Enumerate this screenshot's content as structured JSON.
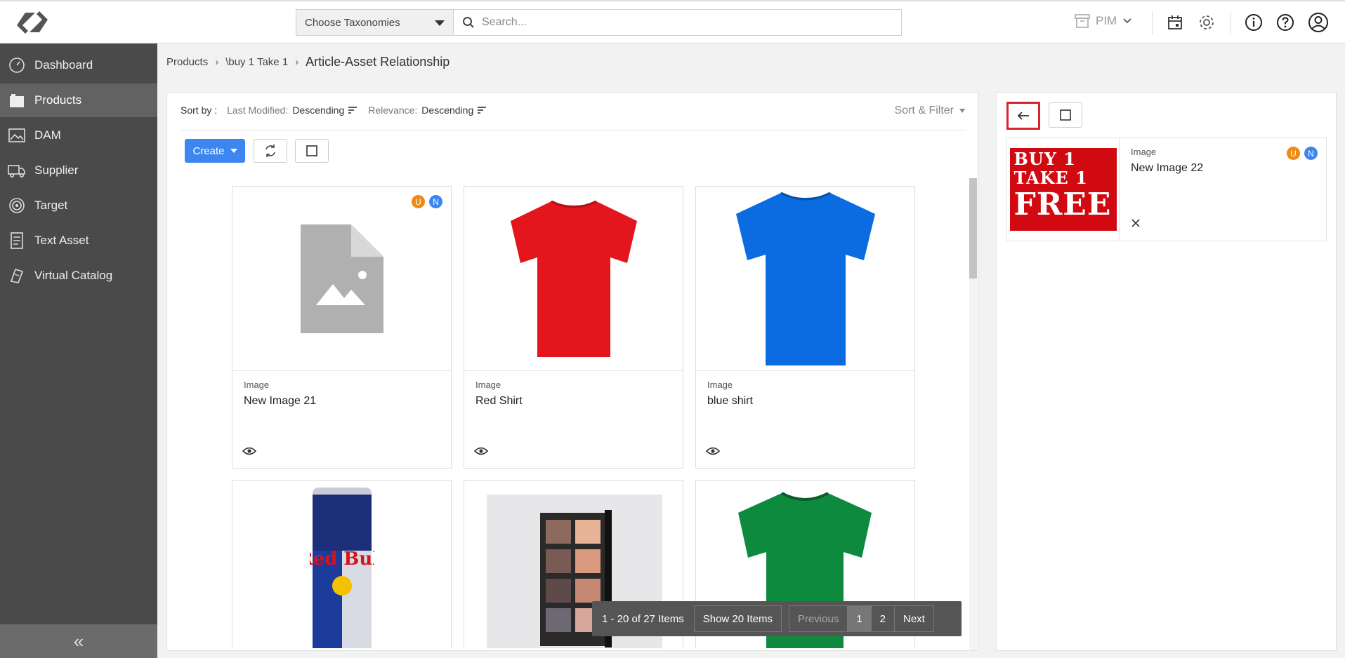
{
  "header": {
    "taxonomy_placeholder": "Choose Taxonomies",
    "search_placeholder": "Search...",
    "module_label": "PIM"
  },
  "sidebar": {
    "items": [
      {
        "label": "Dashboard",
        "icon": "dashboard-icon"
      },
      {
        "label": "Products",
        "icon": "products-icon",
        "active": true
      },
      {
        "label": "DAM",
        "icon": "image-icon"
      },
      {
        "label": "Supplier",
        "icon": "truck-icon"
      },
      {
        "label": "Target",
        "icon": "target-icon"
      },
      {
        "label": "Text Asset",
        "icon": "text-asset-icon"
      },
      {
        "label": "Virtual Catalog",
        "icon": "catalog-icon"
      }
    ],
    "collapse_glyph": "«"
  },
  "breadcrumb": {
    "items": [
      "Products",
      "\\buy 1 Take 1"
    ],
    "current": "Article-Asset Relationship"
  },
  "sort": {
    "label": "Sort by :",
    "last_modified_label": "Last Modified:",
    "last_modified_value": "Descending",
    "relevance_label": "Relevance:",
    "relevance_value": "Descending",
    "sort_filter_label": "Sort & Filter"
  },
  "toolbar": {
    "create_label": "Create"
  },
  "cards": [
    {
      "type": "Image",
      "name": "New Image 21",
      "badges": [
        "U",
        "N"
      ]
    },
    {
      "type": "Image",
      "name": "Red Shirt"
    },
    {
      "type": "Image",
      "name": "blue shirt"
    }
  ],
  "pager": {
    "count": "1 - 20 of 27 Items",
    "show": "Show 20 Items",
    "previous": "Previous",
    "pages": [
      "1",
      "2"
    ],
    "next": "Next"
  },
  "right_panel": {
    "card": {
      "type": "Image",
      "name": "New Image 22",
      "badges": [
        "U",
        "N"
      ],
      "promo_lines": [
        "BUY 1",
        "TAKE 1",
        "FREE"
      ]
    }
  },
  "colors": {
    "accent": "#3d86f0",
    "badge_u": "#f08a14",
    "badge_n": "#3d86f0",
    "highlight": "#d9232e",
    "sidebar": "#4a4a4a"
  }
}
